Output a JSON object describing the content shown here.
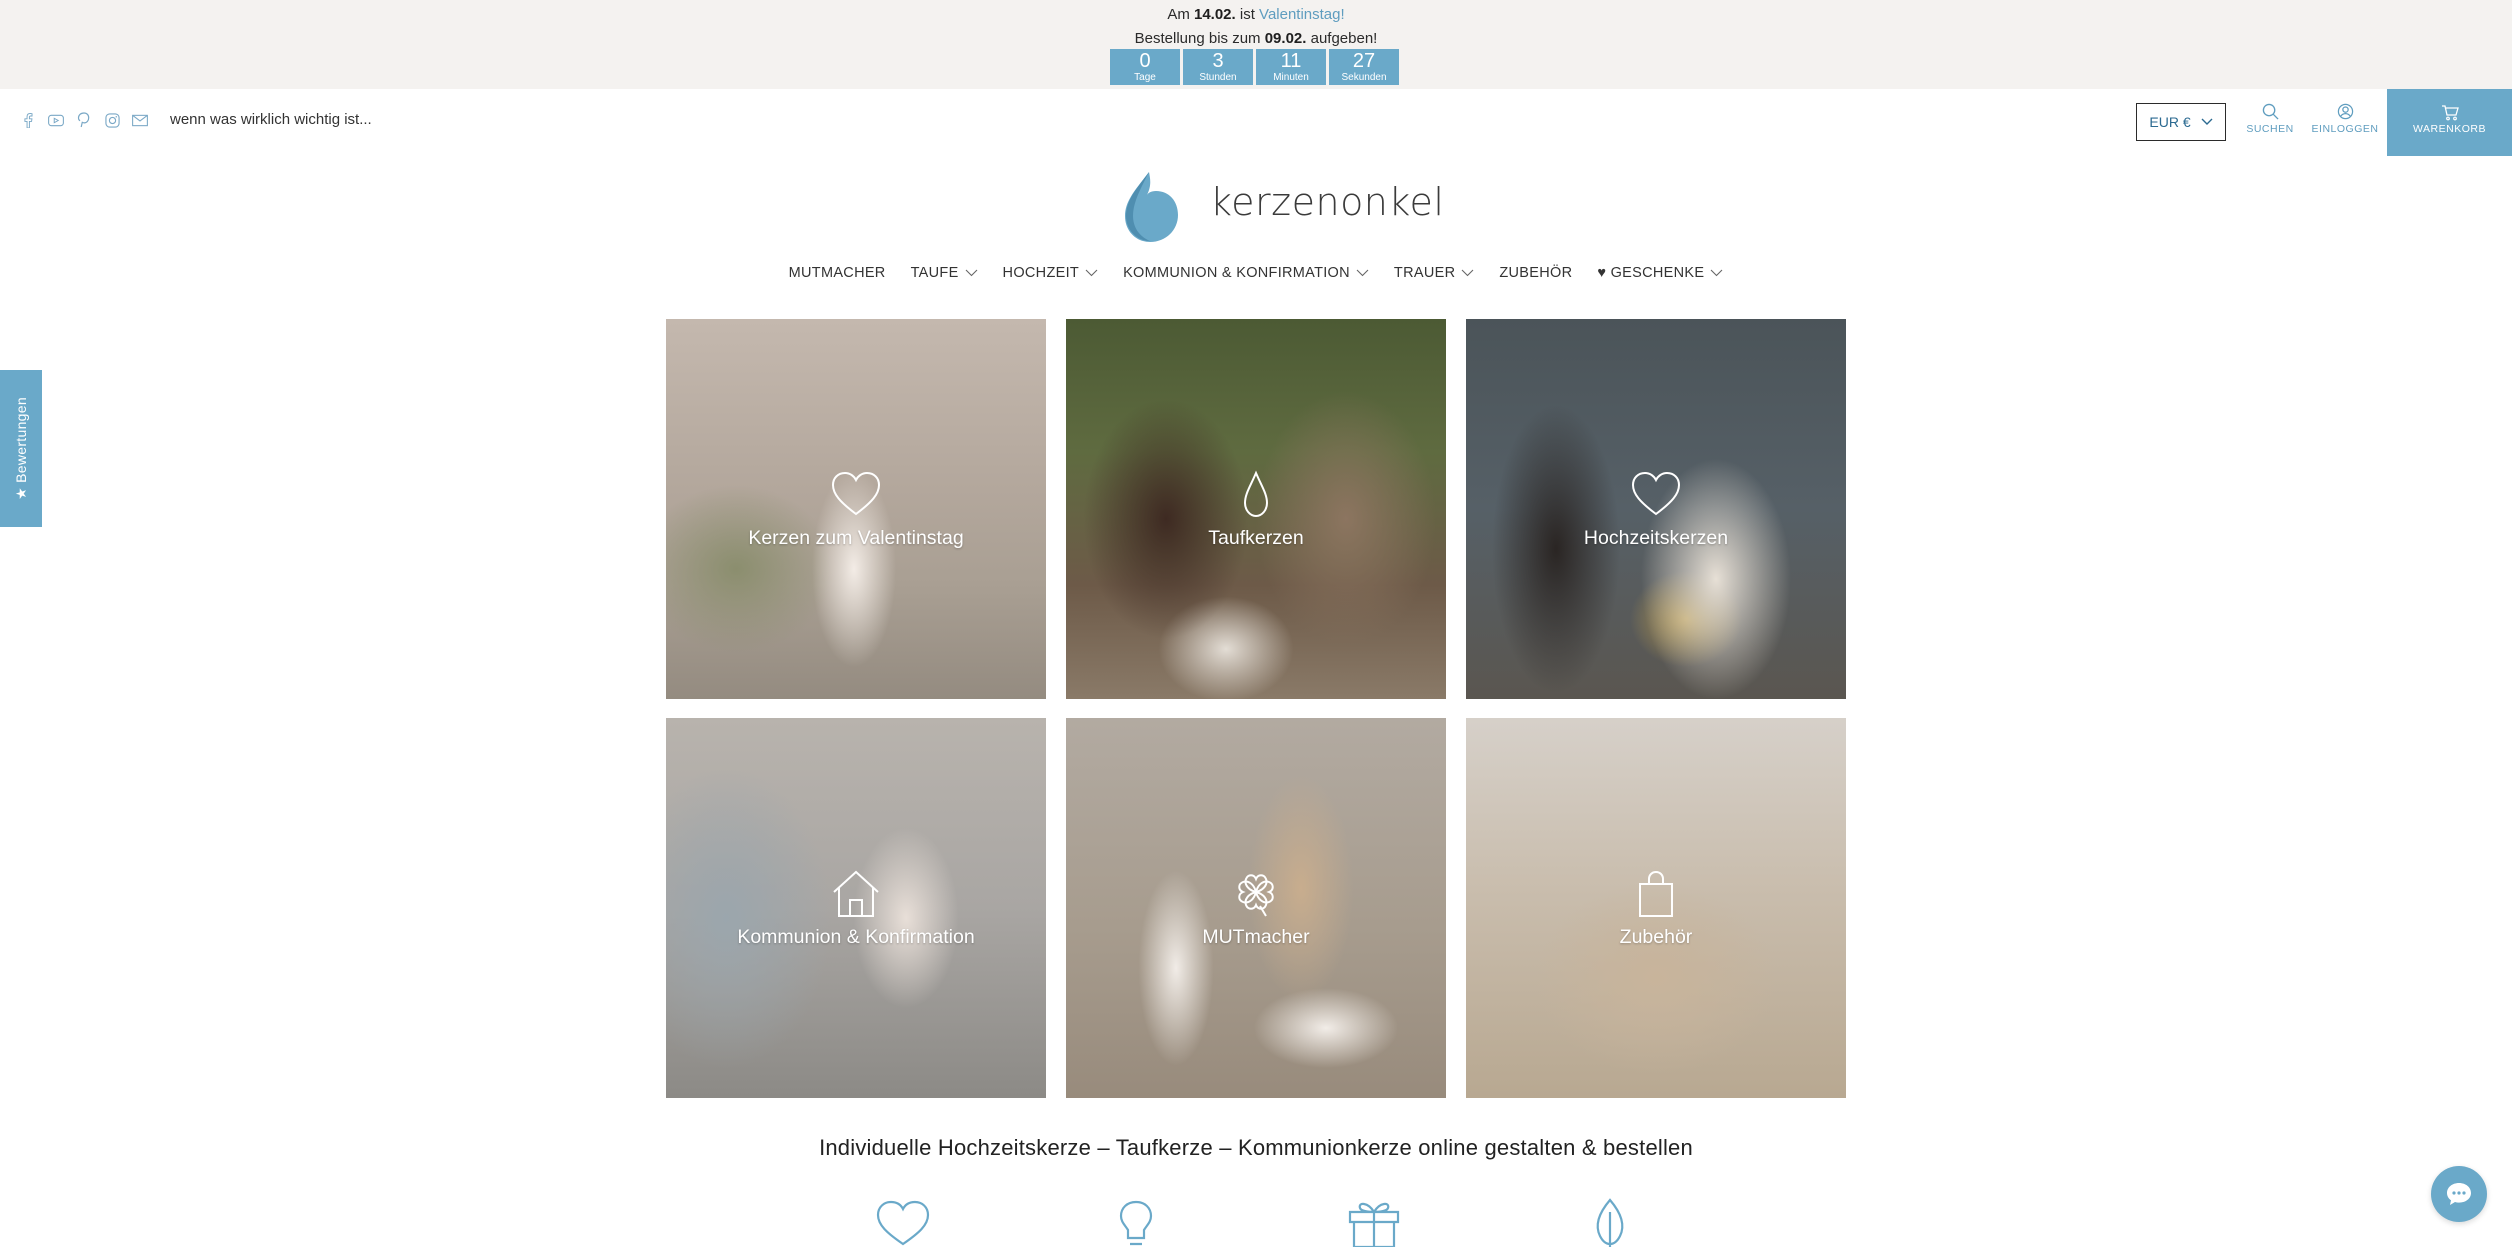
{
  "promo": {
    "l1_prefix": "Am",
    "l1_date": "14.02.",
    "l1_mid": "ist",
    "l1_event": "Valentinstag!",
    "l2_prefix": "Bestellung bis zum",
    "l2_date": "09.02.",
    "l2_suffix": "aufgeben!",
    "countdown": [
      {
        "value": "0",
        "label": "Tage"
      },
      {
        "value": "3",
        "label": "Stunden"
      },
      {
        "value": "11",
        "label": "Minuten"
      },
      {
        "value": "27",
        "label": "Sekunden"
      }
    ]
  },
  "header": {
    "social_icons": [
      "facebook-icon",
      "youtube-icon",
      "pinterest-icon",
      "instagram-icon",
      "mail-icon"
    ],
    "tagline": "wenn was wirklich wichtig ist...",
    "currency": "EUR €",
    "search_label": "SUCHEN",
    "login_label": "EINLOGGEN",
    "cart_label": "WARENKORB"
  },
  "logo": {
    "text": "kerzenonkel",
    "color": "#6aa9c9"
  },
  "nav": [
    {
      "label": "MUTMACHER",
      "has_dropdown": false
    },
    {
      "label": "TAUFE",
      "has_dropdown": true
    },
    {
      "label": "HOCHZEIT",
      "has_dropdown": true
    },
    {
      "label": "KOMMUNION & KONFIRMATION",
      "has_dropdown": true
    },
    {
      "label": "TRAUER",
      "has_dropdown": true
    },
    {
      "label": "ZUBEHÖR",
      "has_dropdown": false
    },
    {
      "label": "♥ GESCHENKE",
      "has_dropdown": true
    }
  ],
  "tiles": [
    {
      "label": "Kerzen zum Valentinstag",
      "icon": "heart-icon"
    },
    {
      "label": "Taufkerzen",
      "icon": "drop-icon"
    },
    {
      "label": "Hochzeitskerzen",
      "icon": "heart-icon"
    },
    {
      "label": "Kommunion & Konfirmation",
      "icon": "church-icon"
    },
    {
      "label": "MUTmacher",
      "icon": "clover-icon"
    },
    {
      "label": "Zubehör",
      "icon": "bag-icon"
    }
  ],
  "subhead": "Individuelle Hochzeitskerze – Taufkerze – Kommunionkerze online gestalten & bestellen",
  "usp_icons": [
    "heart-icon",
    "lightbulb-icon",
    "gift-icon",
    "leaf-icon"
  ],
  "reviews_tab": "★ Bewertungen",
  "accent_color": "#6aa9c9"
}
